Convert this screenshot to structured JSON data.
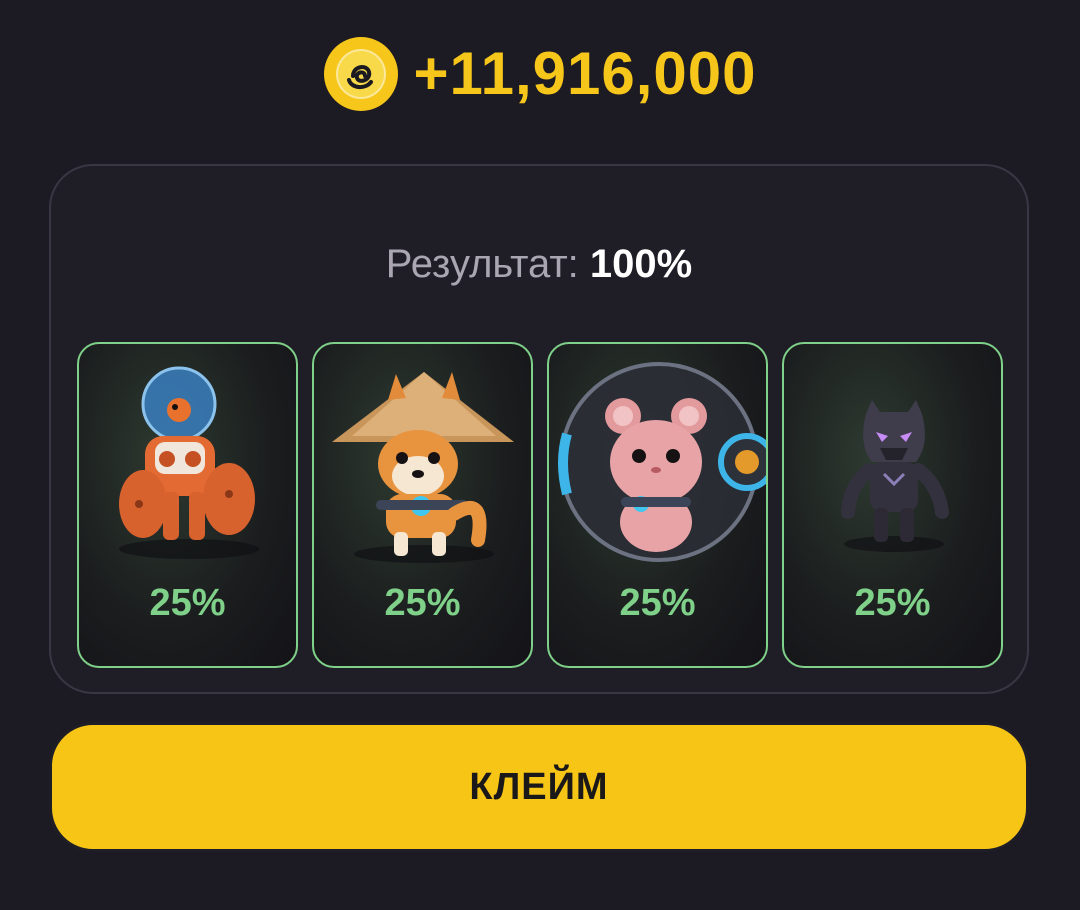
{
  "reward": {
    "amount": "+11,916,000",
    "icon": "coin-icon"
  },
  "result": {
    "label": "Результат:",
    "value": "100%"
  },
  "cards": [
    {
      "name": "robot-card",
      "icon": "robot-diver-icon",
      "percent": "25%"
    },
    {
      "name": "dog-card",
      "icon": "shiba-dog-hat-icon",
      "percent": "25%"
    },
    {
      "name": "hamster-card",
      "icon": "hamster-ball-icon",
      "percent": "25%"
    },
    {
      "name": "panther-card",
      "icon": "black-panther-icon",
      "percent": "25%"
    }
  ],
  "claim_button": {
    "label": "КЛЕЙМ"
  },
  "colors": {
    "accent_yellow": "#f6c515",
    "card_green": "#7fd089",
    "background": "#1c1a22"
  }
}
